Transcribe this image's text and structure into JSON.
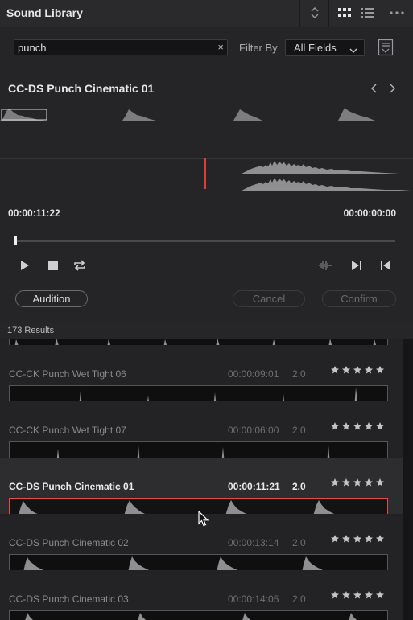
{
  "window": {
    "title": "Sound Library"
  },
  "toolbar": {
    "icons": [
      "sort-icon",
      "grid-view-icon",
      "list-view-icon",
      "more-icon"
    ]
  },
  "search": {
    "value": "punch",
    "clear_glyph": "×"
  },
  "filter": {
    "label": "Filter By",
    "value": "All Fields"
  },
  "preview": {
    "clip_title": "CC-DS Punch Cinematic 01",
    "timecode_current": "00:00:11:22",
    "timecode_duration": "00:00:00:00",
    "scrub_progress": 0
  },
  "actions": {
    "audition": "Audition",
    "cancel": "Cancel",
    "confirm": "Confirm"
  },
  "results": {
    "count_label": "173 Results"
  },
  "clips": [
    {
      "name": "CC-CK Punch Wet Tight 06",
      "duration": "00:00:09:01",
      "channels": "2.0",
      "rating": 0,
      "selected": false
    },
    {
      "name": "CC-CK Punch Wet Tight 07",
      "duration": "00:00:06:00",
      "channels": "2.0",
      "rating": 0,
      "selected": false
    },
    {
      "name": "CC-DS Punch Cinematic 01",
      "duration": "00:00:11:21",
      "channels": "2.0",
      "rating": 0,
      "selected": true
    },
    {
      "name": "CC-DS Punch Cinematic 02",
      "duration": "00:00:13:14",
      "channels": "2.0",
      "rating": 0,
      "selected": false
    },
    {
      "name": "CC-DS Punch Cinematic 03",
      "duration": "00:00:14:05",
      "channels": "2.0",
      "rating": 0,
      "selected": false
    }
  ],
  "colors": {
    "accent": "#e0503f",
    "playhead": "#d8413a",
    "background": "#1b1b1d",
    "waveform": "#8f8f91"
  }
}
